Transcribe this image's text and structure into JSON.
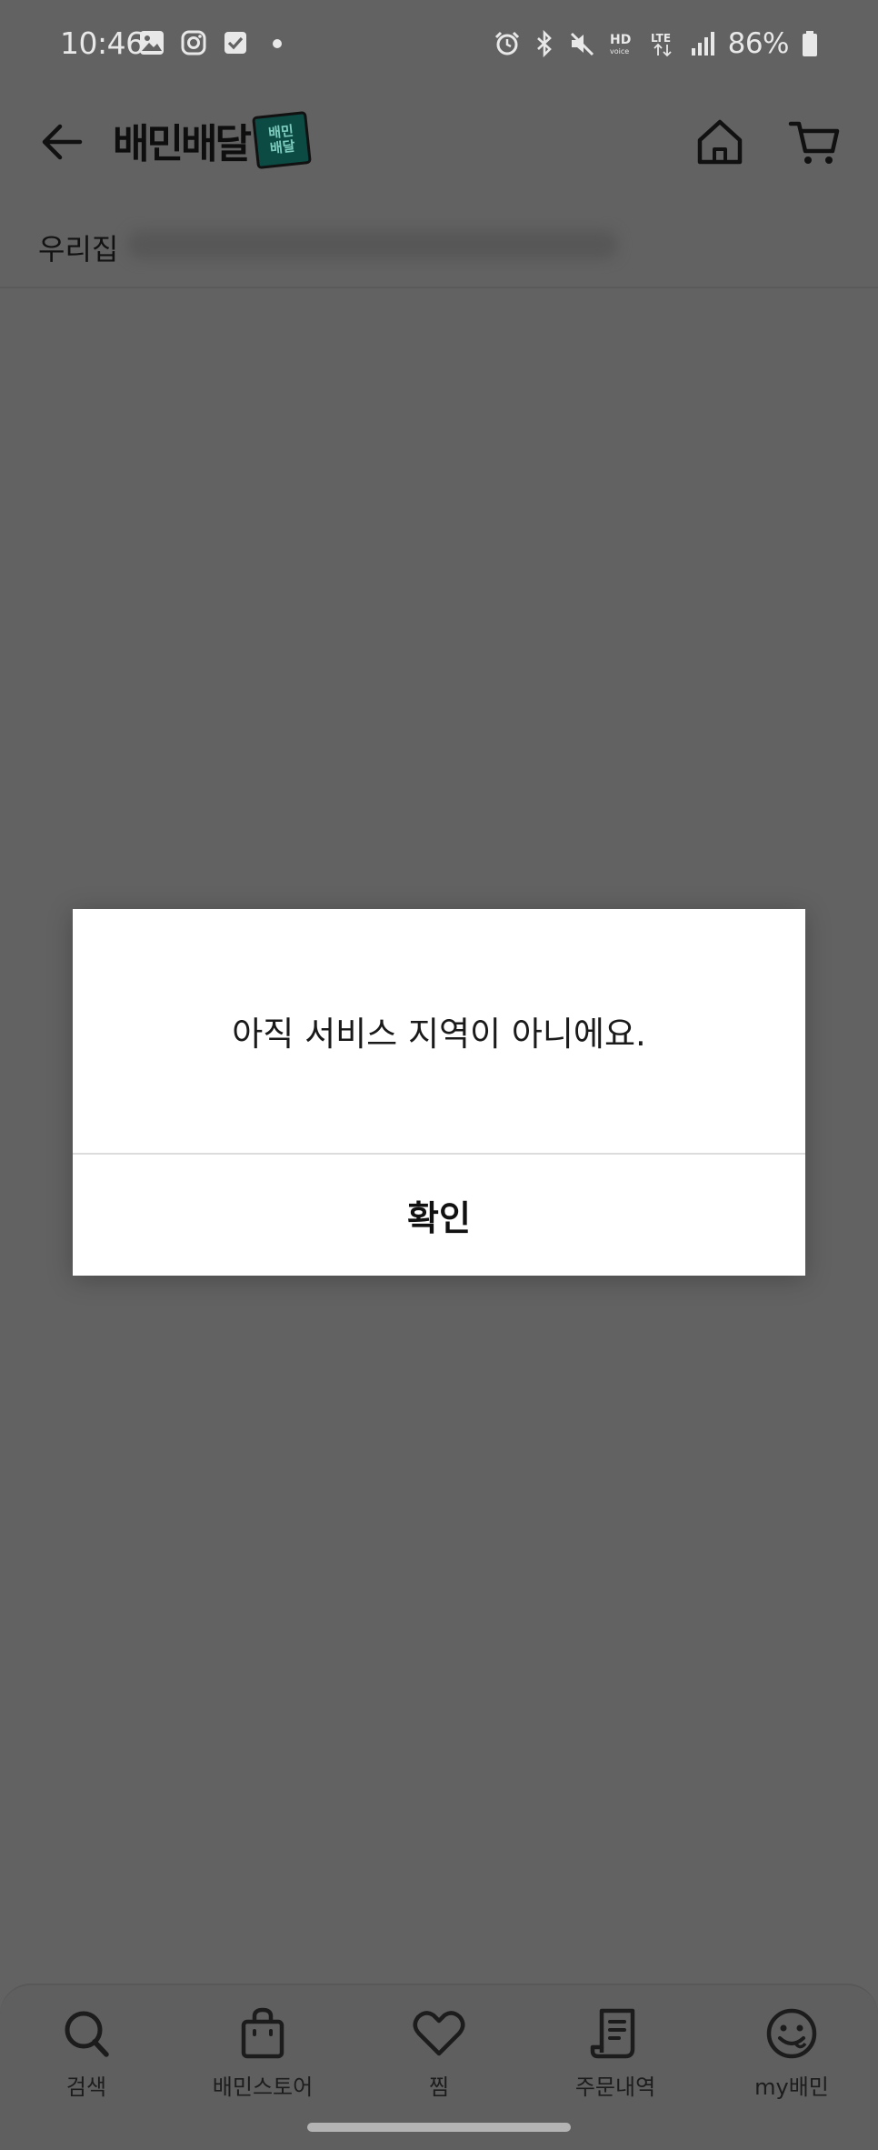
{
  "status_bar": {
    "time": "10:46",
    "battery": "86%",
    "icons": [
      "gallery-icon",
      "instagram-icon",
      "tasks-icon",
      "dot-icon",
      "alarm-icon",
      "bluetooth-icon",
      "mute-icon",
      "hd-voice-icon",
      "lte-icon",
      "signal-icon",
      "battery-icon"
    ]
  },
  "header": {
    "brand": "배민배달",
    "brand_badge_line1": "배민",
    "brand_badge_line2": "배달",
    "icons": [
      "back-arrow-icon",
      "home-icon",
      "cart-icon"
    ]
  },
  "address": {
    "label": "우리집"
  },
  "dialog": {
    "message": "아직 서비스 지역이 아니에요.",
    "confirm_label": "확인"
  },
  "tab_bar": {
    "items": [
      {
        "label": "검색",
        "icon": "search-icon"
      },
      {
        "label": "배민스토어",
        "icon": "shopping-bag-icon"
      },
      {
        "label": "찜",
        "icon": "heart-icon"
      },
      {
        "label": "주문내역",
        "icon": "receipt-icon"
      },
      {
        "label": "my배민",
        "icon": "face-icon"
      }
    ]
  },
  "colors": {
    "overlay_bg": "#626262",
    "dialog_bg": "#ffffff",
    "text_dark": "#111111",
    "brand_badge": "#0c4a44"
  }
}
